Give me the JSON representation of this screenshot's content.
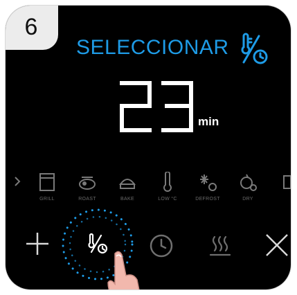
{
  "step": {
    "number": "6"
  },
  "header": {
    "title": "SELECCIONAR",
    "icon": "thermo-timer-icon",
    "accent_color": "#1e9be6"
  },
  "timer": {
    "value": "23",
    "unit": "min"
  },
  "modes": [
    {
      "label": "",
      "icon": "partial-mode-icon"
    },
    {
      "label": "GRILL",
      "icon": "grill-icon"
    },
    {
      "label": "ROAST",
      "icon": "roast-icon"
    },
    {
      "label": "BAKE",
      "icon": "bake-icon"
    },
    {
      "label": "LOW °C",
      "icon": "low-temp-icon"
    },
    {
      "label": "DEFROST",
      "icon": "defrost-icon"
    },
    {
      "label": "DRY",
      "icon": "dry-icon"
    },
    {
      "label": "",
      "icon": "partial-mode-icon"
    }
  ],
  "controls": {
    "plus": "plus-icon",
    "temp_time": "thermo-timer-icon",
    "clock": "clock-icon",
    "warm": "keep-warm-icon",
    "close": "close-icon"
  }
}
